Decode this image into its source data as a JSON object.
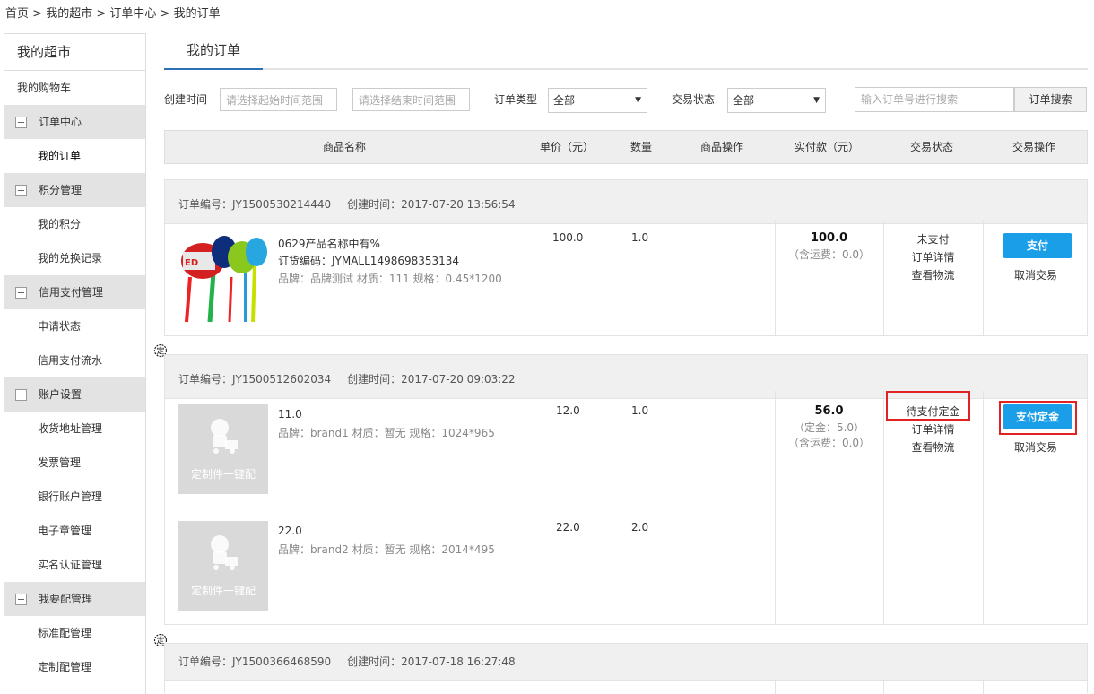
{
  "breadcrumb": [
    "首页",
    "我的超市",
    "订单中心",
    "我的订单"
  ],
  "breadcrumb_sep": " > ",
  "sidebar": {
    "title": "我的超市",
    "cart": "我的购物车",
    "groups": [
      {
        "label": "订单中心",
        "items": [
          "我的订单"
        ]
      },
      {
        "label": "积分管理",
        "items": [
          "我的积分",
          "我的兑换记录"
        ]
      },
      {
        "label": "信用支付管理",
        "items": [
          "申请状态",
          "信用支付流水"
        ]
      },
      {
        "label": "账户设置",
        "items": [
          "收货地址管理",
          "发票管理",
          "银行账户管理",
          "电子章管理",
          "实名认证管理"
        ]
      },
      {
        "label": "我要配管理",
        "items": [
          "标准配管理",
          "定制配管理"
        ]
      }
    ]
  },
  "tab": "我的订单",
  "filters": {
    "created_label": "创建时间",
    "start_placeholder": "请选择起始时间范围",
    "dash": "-",
    "end_placeholder": "请选择结束时间范围",
    "type_label": "订单类型",
    "type_value": "全部",
    "status_label": "交易状态",
    "status_value": "全部",
    "search_placeholder": "输入订单号进行搜索",
    "search_button": "订单搜索"
  },
  "table_headers": [
    "商品名称",
    "单价（元）",
    "数量",
    "商品操作",
    "实付款（元）",
    "交易状态",
    "交易操作"
  ],
  "orders": [
    {
      "number": "订单编号：JY1500530214440",
      "created": "创建时间：2017-07-20 13:56:54",
      "products": [
        {
          "name": "0629产品名称中有%",
          "code": "订货编码：JYMALL1498698353134",
          "attrs": "品牌：品牌测试 材质：111 规格：0.45*1200",
          "price": "100.0",
          "qty": "1.0"
        }
      ],
      "total": "100.0",
      "extra": [
        "（含运费：0.0）"
      ],
      "status": "未支付",
      "detail": "订单详情",
      "logistics": "查看物流",
      "pay": "支付",
      "cancel": "取消交易"
    },
    {
      "number": "订单编号：JY1500512602034",
      "created": "创建时间：2017-07-20 09:03:22",
      "products": [
        {
          "name": "11.0",
          "attrs": "品牌：brand1 材质：暂无 规格：1024*965",
          "price": "12.0",
          "qty": "1.0",
          "placeholder": "定制件一键配"
        },
        {
          "name": "22.0",
          "attrs": "品牌：brand2 材质：暂无 规格：2014*495",
          "price": "22.0",
          "qty": "2.0",
          "placeholder": "定制件一键配"
        }
      ],
      "total": "56.0",
      "extra": [
        "（定金：5.0）",
        "（含运费：0.0）"
      ],
      "status": "待支付定金",
      "detail": "订单详情",
      "logistics": "查看物流",
      "pay": "支付定金",
      "cancel": "取消交易"
    },
    {
      "number": "订单编号：JY1500366468590",
      "created": "创建时间：2017-07-18 16:27:48"
    }
  ],
  "side_mark": "定",
  "colors": {
    "accent": "#1a9ee8",
    "highlight": "#e02222",
    "tab_underline": "#2d6fb6"
  }
}
